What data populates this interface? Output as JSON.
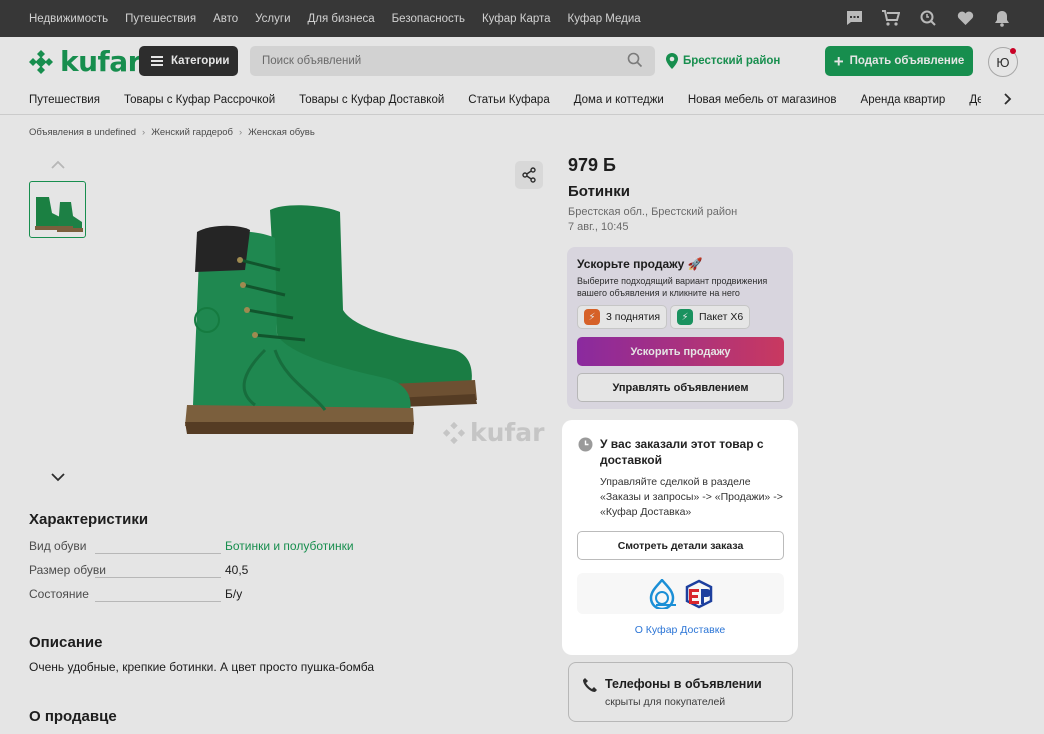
{
  "topbar": {
    "links": [
      "Недвижимость",
      "Путешествия",
      "Авто",
      "Услуги",
      "Для бизнеса",
      "Безопасность",
      "Куфар Карта",
      "Куфар Медиа"
    ],
    "icons": [
      "chat-icon",
      "cart-icon",
      "search-history-icon",
      "heart-icon",
      "bell-icon"
    ]
  },
  "header": {
    "logo": "kufar",
    "categories_label": "Категории",
    "search_placeholder": "Поиск объявлений",
    "region": "Брестский район",
    "post_label": "Подать объявление",
    "avatar_letter": "Ю"
  },
  "catbar": {
    "items": [
      "Путешествия",
      "Товары с Куфар Рассрочкой",
      "Товары с Куфар Доставкой",
      "Статьи Куфара",
      "Дома и коттеджи",
      "Новая мебель от магазинов",
      "Аренда квартир",
      "Детск"
    ]
  },
  "breadcrumbs": [
    "Объявления в undefined",
    "Женский гардероб",
    "Женская обувь"
  ],
  "gallery": {
    "watermark": "kufar"
  },
  "characteristics": {
    "title": "Характеристики",
    "rows": [
      {
        "key": "Вид обуви",
        "value": "Ботинки и полуботинки",
        "link": true
      },
      {
        "key": "Размер обуви",
        "value": "40,5",
        "link": false
      },
      {
        "key": "Состояние",
        "value": "Б/у",
        "link": false
      }
    ]
  },
  "description": {
    "title": "Описание",
    "text": "Очень удобные, крепкие ботинки. А цвет просто пушка-бомба"
  },
  "seller": {
    "title": "О продавце"
  },
  "product": {
    "price": "979 Б",
    "title": "Ботинки",
    "location": "Брестская обл., Брестский район",
    "date": "7 авг., 10:45"
  },
  "promo": {
    "title": "Ускорьте продажу 🚀",
    "text": "Выберите подходящий вариант продвижения вашего объявления и кликните на него",
    "chips": [
      "3 поднятия",
      "Пакет Х6"
    ],
    "boost_label": "Ускорить продажу",
    "manage_label": "Управлять объявлением"
  },
  "order_card": {
    "title": "У вас заказали этот товар с доставкой",
    "text": "Управляйте сделкой в разделе «Заказы и запросы» -> «Продажи» -> «Куфар Доставка»",
    "button_label": "Смотреть детали заказа",
    "link_label": "О Куфар Доставке"
  },
  "phones": {
    "title": "Телефоны в объявлении",
    "subtitle": "скрыты для покупателей"
  },
  "colors": {
    "brand_green": "#1a9f57",
    "topbar": "#3e3e3e",
    "link_blue": "#2b75d6"
  }
}
